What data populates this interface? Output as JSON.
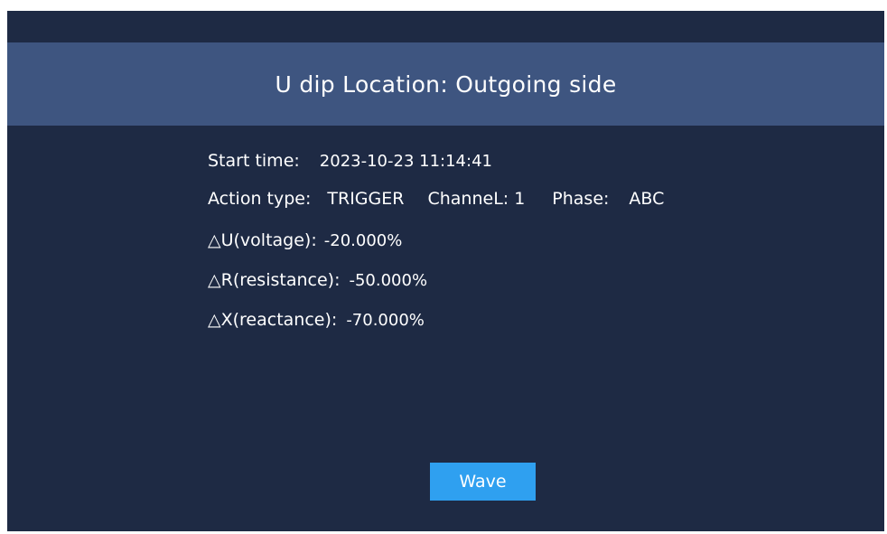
{
  "header": {
    "title": "U dip Location: Outgoing side"
  },
  "details": {
    "start_time_label": "Start time:",
    "start_time_value": "2023-10-23 11:14:41",
    "action_type_label": "Action type:",
    "action_type_value": "TRIGGER",
    "channel_label": "ChanneL:",
    "channel_value": "1",
    "phase_label": "Phase:",
    "phase_value": "ABC",
    "voltage_label": "△U(voltage):",
    "voltage_value": "-20.000%",
    "resistance_label": "△R(resistance):",
    "resistance_value": "-50.000%",
    "reactance_label": "△X(reactance):",
    "reactance_value": "-70.000%"
  },
  "actions": {
    "wave_label": "Wave"
  },
  "colors": {
    "panel_background": "#1e2a44",
    "title_bar": "#3e5580",
    "button": "#2fa0f0",
    "text": "#ffffff"
  }
}
